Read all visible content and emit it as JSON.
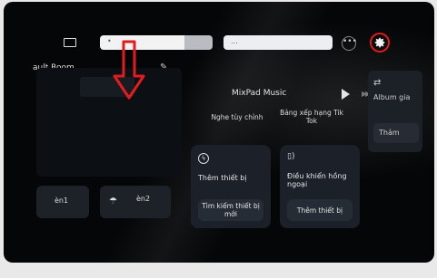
{
  "topbar": {
    "search_a_text": "•",
    "search_b_text": "...",
    "more_label": "•••"
  },
  "room": {
    "name": "ault Room"
  },
  "music": {
    "title": "MixPad Music"
  },
  "scenes": [
    {
      "label": "Nghe tùy chỉnh"
    },
    {
      "label": "Bảng xếp hạng Tik Tok"
    }
  ],
  "album": {
    "label": "Album gia",
    "button": "Thảm"
  },
  "cards": {
    "add_device": {
      "title": "Thêm thiết bị",
      "button": "Tìm kiếm thiết bị mới"
    },
    "ir_remote": {
      "title": "Điều khiển hồng ngoại",
      "button": "Thêm thiết bị"
    }
  },
  "tiles": [
    {
      "label": "èn1"
    },
    {
      "label": "èn2"
    }
  ],
  "accent_colors": {
    "highlight_red": "#e21c1c"
  },
  "icons": [
    "tv-icon",
    "settings-gear-icon",
    "edit-pencil-icon",
    "play-icon",
    "fast-forward-icon",
    "shuffle-icon",
    "lightning-icon",
    "remote-icon",
    "lamp-icon"
  ]
}
